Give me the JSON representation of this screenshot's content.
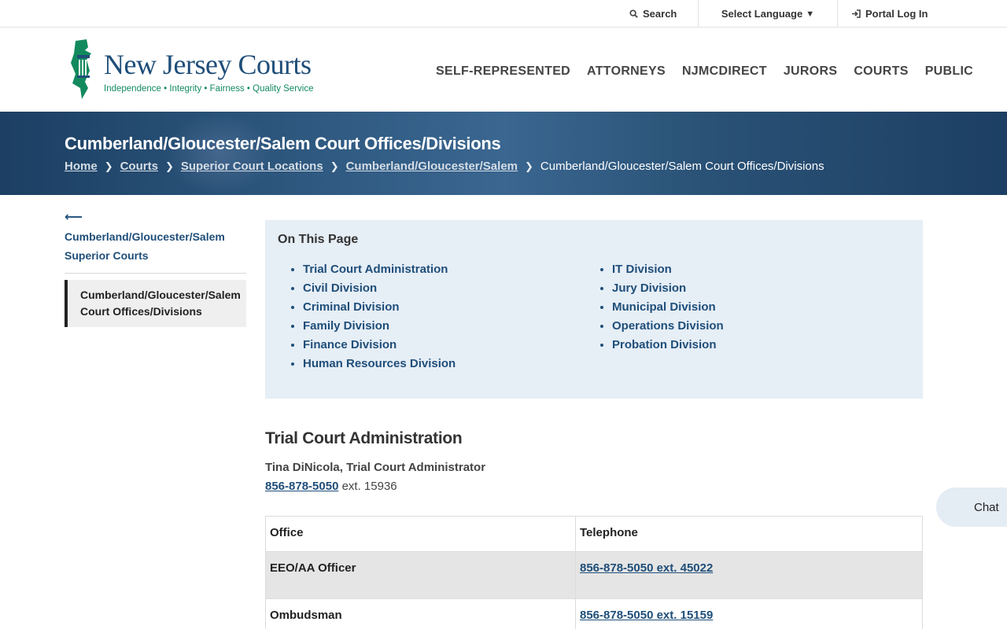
{
  "utility": {
    "search_label": "Search",
    "language_label": "Select Language",
    "portal_label": "Portal Log In"
  },
  "logo": {
    "title": "New Jersey Courts",
    "tagline": "Independence • Integrity • Fairness • Quality Service"
  },
  "nav": {
    "items": [
      "SELF-REPRESENTED",
      "ATTORNEYS",
      "NJMCDIRECT",
      "JURORS",
      "COURTS",
      "PUBLIC"
    ]
  },
  "banner": {
    "title": "Cumberland/Gloucester/Salem Court Offices/Divisions",
    "breadcrumb": [
      "Home",
      "Courts",
      "Superior Court Locations",
      "Cumberland/Gloucester/Salem"
    ],
    "current": "Cumberland/Gloucester/Salem Court Offices/Divisions"
  },
  "sidebar": {
    "back_link_line1": "Cumberland/Gloucester/Salem",
    "back_link_line2": "Superior Courts",
    "active_line1": "Cumberland/Gloucester/Salem",
    "active_line2": "Court Offices/Divisions"
  },
  "on_this_page": {
    "heading": "On This Page",
    "col1": [
      "Trial Court Administration",
      "Civil Division",
      "Criminal Division",
      "Family Division",
      "Finance Division",
      "Human Resources Division"
    ],
    "col2": [
      "IT Division",
      "Jury Division",
      "Municipal Division",
      "Operations Division",
      "Probation Division"
    ]
  },
  "trial_court": {
    "heading": "Trial Court Administration",
    "administrator": "Tina DiNicola, Trial Court Administrator",
    "phone": "856-878-5050",
    "ext": " ext. 15936"
  },
  "table": {
    "headers": [
      "Office",
      "Telephone"
    ],
    "rows": [
      {
        "office": "EEO/AA Officer",
        "phone": "856-878-5050 ext. 45022"
      },
      {
        "office": "Ombudsman",
        "phone": "856-878-5050 ext. 15159"
      }
    ]
  },
  "chat": {
    "label": "Chat"
  },
  "colors": {
    "brand_blue": "#1f4e79",
    "brand_green": "#138a5e",
    "banner": "#1c3f63"
  }
}
